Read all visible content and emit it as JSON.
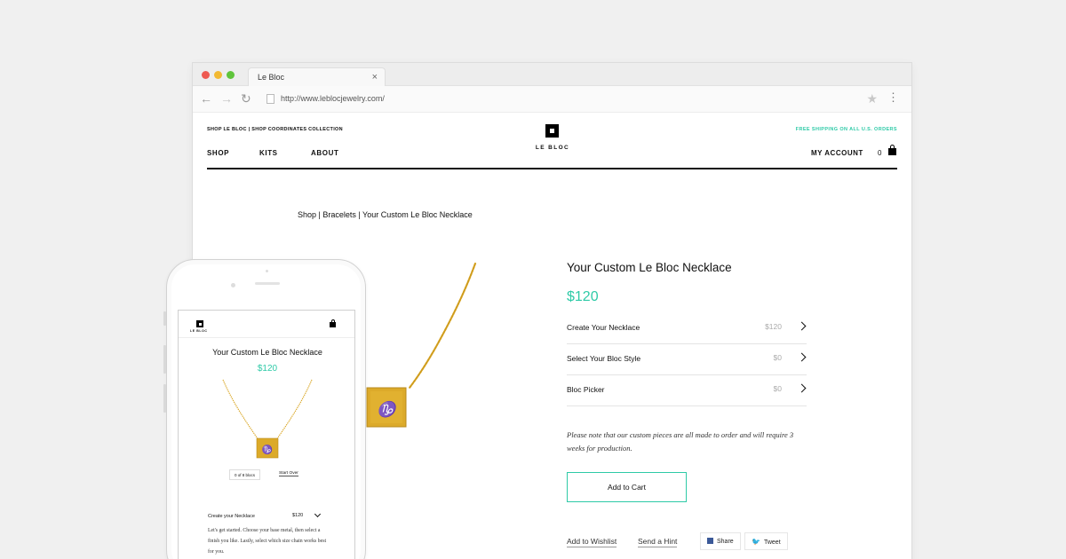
{
  "browser": {
    "tab_title": "Le Bloc",
    "tab_close": "×",
    "url": "http://www.leblocjewelry.com/",
    "back": "←",
    "forward": "→",
    "reload": "↻",
    "bookmark": "★",
    "menu": "⋮"
  },
  "header": {
    "util_links": "SHOP LE BLOC | SHOP COORDINATES COLLECTION",
    "shipping_banner": "FREE SHIPPING ON ALL U.S. ORDERS",
    "logo_text": "LE BLOC",
    "nav": [
      "SHOP",
      "KITS",
      "ABOUT"
    ],
    "account": "MY ACCOUNT",
    "cart_count": "0"
  },
  "breadcrumb": "Shop | Bracelets | Your Custom Le Bloc Necklace",
  "product": {
    "title": "Your Custom Le Bloc Necklace",
    "price": "$120",
    "options": [
      {
        "label": "Create Your Necklace",
        "price": "$120"
      },
      {
        "label": "Select Your Bloc Style",
        "price": "$0"
      },
      {
        "label": "Bloc Picker",
        "price": "$0"
      }
    ],
    "note": "Please note that our custom pieces are all made to order and will require 3 weeks for production.",
    "add_to_cart": "Add to Cart",
    "wishlist": "Add to Wishlist",
    "hint": "Send a Hint",
    "share": "Share",
    "tweet": "Tweet"
  },
  "mobile": {
    "logo_text": "LE BLOC",
    "title": "Your Custom Le Bloc Necklace",
    "price": "$120",
    "bloc_count": "0 of 8 blocs",
    "start_over": "Start Over",
    "step_label": "Create your Necklace",
    "step_price": "$120",
    "step_copy": "Let's get started. Choose your base metal, then select a finish you like. Lastly, select which size chain works best for you."
  },
  "colors": {
    "accent": "#2ecaa7",
    "gold": "#d9a521",
    "text": "#111111"
  }
}
